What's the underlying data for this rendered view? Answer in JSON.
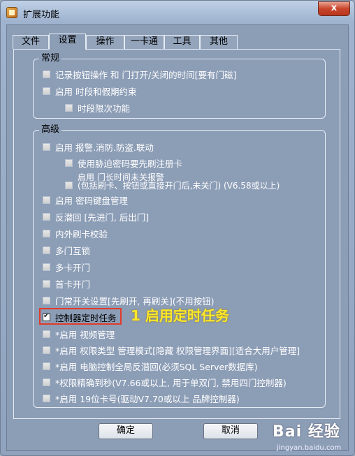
{
  "window": {
    "title": "扩展功能",
    "close_label": "x"
  },
  "tabs": [
    {
      "label": "文件",
      "active": false
    },
    {
      "label": "设置",
      "active": true
    },
    {
      "label": "操作",
      "active": false
    },
    {
      "label": "一卡通",
      "active": false
    },
    {
      "label": "工具",
      "active": false
    },
    {
      "label": "其他",
      "active": false
    }
  ],
  "general": {
    "title": "常规",
    "items": [
      {
        "label": "记录按钮操作 和 门打开/关闭的时间[要有门磁]",
        "checked": false
      },
      {
        "label": "启用 时段和假期约束",
        "checked": false
      },
      {
        "label": "时段限次功能",
        "checked": false
      }
    ]
  },
  "advanced": {
    "title": "高级",
    "items": [
      {
        "label": "启用 报警.消防.防盗.联动",
        "checked": false
      },
      {
        "label": "使用胁迫密码要先刷注册卡",
        "checked": false
      },
      {
        "label": "启用 门长时间未关报警",
        "label2": "(包括刷卡、按钮或直接开门后,未关门) (V6.58或以上)",
        "checked": false
      },
      {
        "label": "启用 密码键盘管理",
        "checked": false
      },
      {
        "label": "反潜回 [先进门, 后出门]",
        "checked": false
      },
      {
        "label": "内外刷卡校验",
        "checked": false
      },
      {
        "label": "多门互锁",
        "checked": false
      },
      {
        "label": "多卡开门",
        "checked": false
      },
      {
        "label": "首卡开门",
        "checked": false
      },
      {
        "label": "门常开关设置[先刷开, 再刷关](不用按钮)",
        "checked": false
      },
      {
        "label": "控制器定时任务",
        "checked": true
      },
      {
        "label": "*启用 视频管理",
        "checked": false
      },
      {
        "label": "*启用 权限类型 管理模式[隐藏 权限管理界面][适合大用户管理]",
        "checked": false
      },
      {
        "label": "*启用 电脑控制全局反潜回(必须SQL Server数据库)",
        "checked": false
      },
      {
        "label": "*权限精确到秒(V7.66或以上, 用于单双门, 禁用四门控制器)",
        "checked": false
      },
      {
        "label": "*启用 19位卡号(驱动V7.70或以上 品牌控制器)",
        "checked": false
      }
    ]
  },
  "annotation": "1 启用定时任务",
  "buttons": {
    "ok": "确定",
    "cancel": "取消"
  },
  "watermark": {
    "logo": "Bai 经验",
    "url": "jingyan.baidu.com"
  }
}
